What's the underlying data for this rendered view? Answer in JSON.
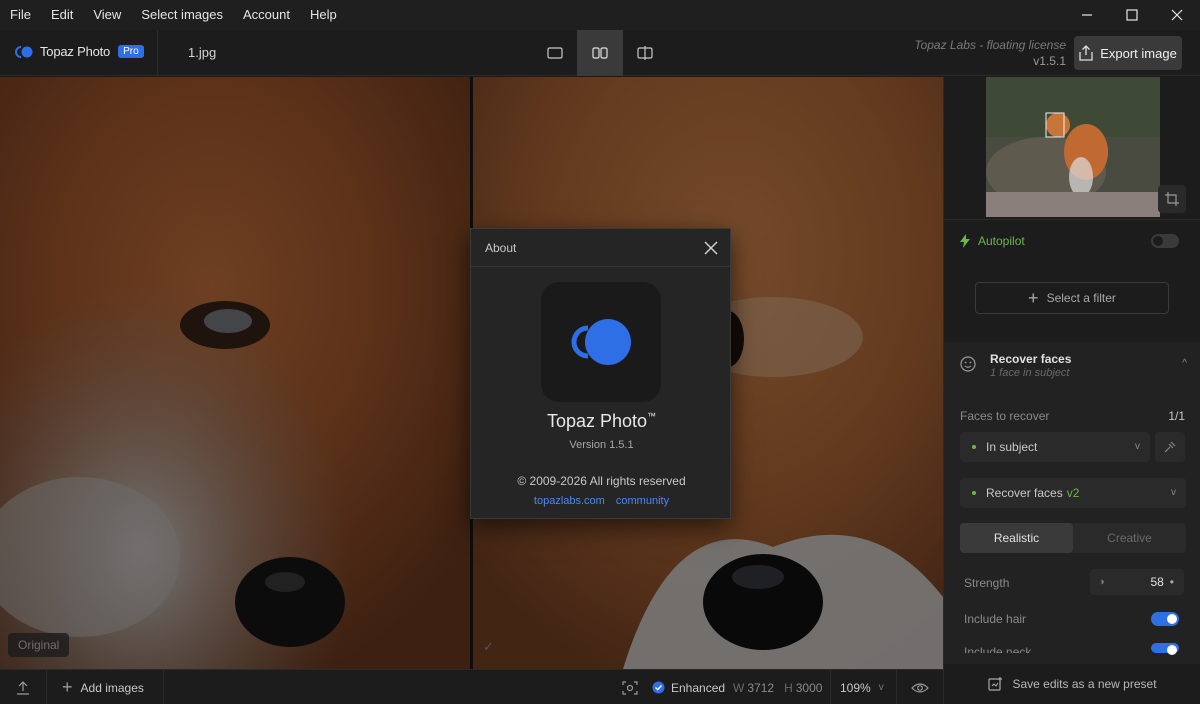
{
  "menu": [
    "File",
    "Edit",
    "View",
    "Select images",
    "Account",
    "Help"
  ],
  "toolbar": {
    "brand": "Topaz Photo",
    "pro_badge": "Pro",
    "file_name": "1.jpg",
    "license": "Topaz Labs - floating license",
    "version": "v1.5.1",
    "export_label": "Export image"
  },
  "canvas": {
    "original_tag": "Original",
    "enhanced_check": "✓"
  },
  "panel": {
    "autopilot_label": "Autopilot",
    "select_filter_label": "Select a filter",
    "recover_faces": {
      "title": "Recover faces",
      "subtitle": "1 face in subject",
      "faces_to_recover_label": "Faces to recover",
      "faces_to_recover_value": "1/1",
      "subject_option": "In subject",
      "model_label": "Recover faces",
      "model_version": "v2",
      "mode_realistic": "Realistic",
      "mode_creative": "Creative",
      "strength_label": "Strength",
      "strength_value": "58",
      "include_hair_label": "Include hair",
      "include_neck_label": "Include neck"
    },
    "save_preset_label": "Save edits as a new preset"
  },
  "bottombar": {
    "add_images_label": "Add images",
    "enhanced_label": "Enhanced",
    "width_label": "W",
    "width_value": "3712",
    "height_label": "H",
    "height_value": "3000",
    "zoom": "109%"
  },
  "about": {
    "title": "About",
    "app_name": "Topaz Photo",
    "trademark": "™",
    "version": "Version 1.5.1",
    "copyright": "© 2009-2026 All rights reserved",
    "link_site": "topazlabs.com",
    "link_community": "community"
  },
  "colors": {
    "accent": "#2f6fe6",
    "autopilot": "#67b84a",
    "link": "#4a8af0"
  }
}
